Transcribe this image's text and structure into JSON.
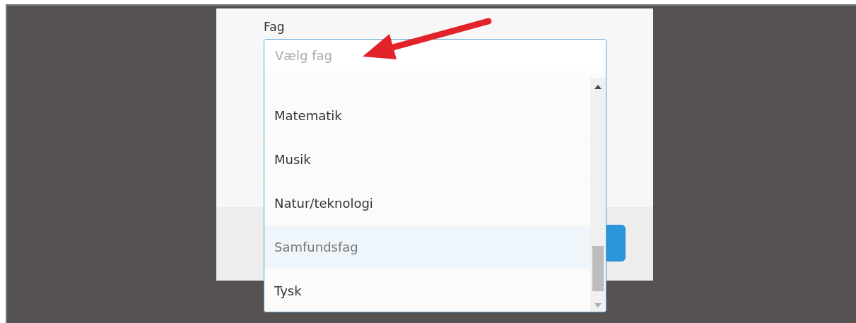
{
  "form": {
    "label": "Fag",
    "placeholder": "Vælg fag"
  },
  "dropdown": {
    "options": [
      {
        "label": "Matematik",
        "selected": false
      },
      {
        "label": "Musik",
        "selected": false
      },
      {
        "label": "Natur/teknologi",
        "selected": false
      },
      {
        "label": "Samfundsfag",
        "selected": true
      },
      {
        "label": "Tysk",
        "selected": false
      }
    ]
  }
}
